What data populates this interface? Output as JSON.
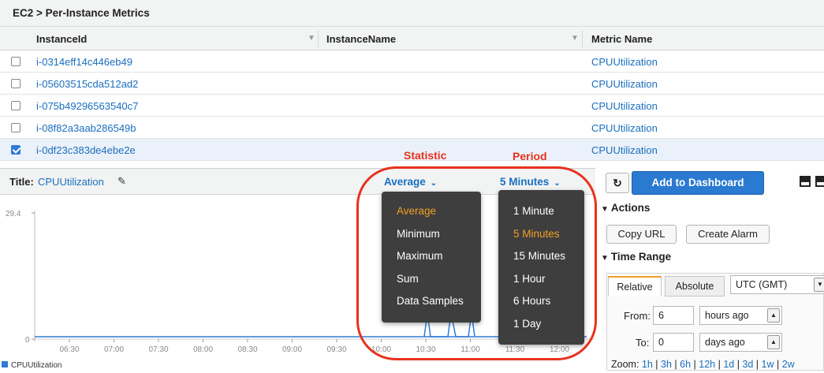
{
  "breadcrumb": "EC2 > Per-Instance Metrics",
  "grid": {
    "columns": [
      "InstanceId",
      "InstanceName",
      "Metric Name"
    ],
    "rows": [
      {
        "id": "i-0314eff14c446eb49",
        "metric": "CPUUtilization",
        "checked": false
      },
      {
        "id": "i-05603515cda512ad2",
        "metric": "CPUUtilization",
        "checked": false
      },
      {
        "id": "i-075b49296563540c7",
        "metric": "CPUUtilization",
        "checked": false
      },
      {
        "id": "i-08f82a3aab286549b",
        "metric": "CPUUtilization",
        "checked": false
      },
      {
        "id": "i-0df23c383de4ebe2e",
        "metric": "CPUUtilization",
        "checked": true
      }
    ]
  },
  "graph": {
    "title_label": "Title:",
    "title_value": "CPUUtilization",
    "statistic_selected": "Average",
    "period_selected": "5 Minutes",
    "y_top": "29.4",
    "y_bottom": "0",
    "x_ticks": [
      "06:30",
      "07:00",
      "07:30",
      "08:00",
      "08:30",
      "09:00",
      "09:30",
      "10:00",
      "10:30",
      "11:00",
      "11:30",
      "12:00"
    ],
    "legend": "CPUUtilization",
    "series_color": "#2f7bd6"
  },
  "annotations": {
    "statistic": "Statistic",
    "period": "Period",
    "color": "#e8321e"
  },
  "statistic_menu": [
    "Average",
    "Minimum",
    "Maximum",
    "Sum",
    "Data Samples"
  ],
  "period_menu": [
    "1 Minute",
    "5 Minutes",
    "15 Minutes",
    "1 Hour",
    "6 Hours",
    "1 Day"
  ],
  "right_panel": {
    "add_to_dashboard": "Add to Dashboard",
    "actions": "Actions",
    "copy_url": "Copy URL",
    "create_alarm": "Create Alarm",
    "time_range": "Time Range",
    "tab_relative": "Relative",
    "tab_absolute": "Absolute",
    "timezone": "UTC (GMT)",
    "from_label": "From:",
    "from_value": "6",
    "from_unit": "hours ago",
    "to_label": "To:",
    "to_value": "0",
    "to_unit": "days ago",
    "zoom_label": "Zoom:",
    "zoom_options": [
      "1h",
      "3h",
      "6h",
      "12h",
      "1d",
      "3d",
      "1w",
      "2w"
    ]
  }
}
